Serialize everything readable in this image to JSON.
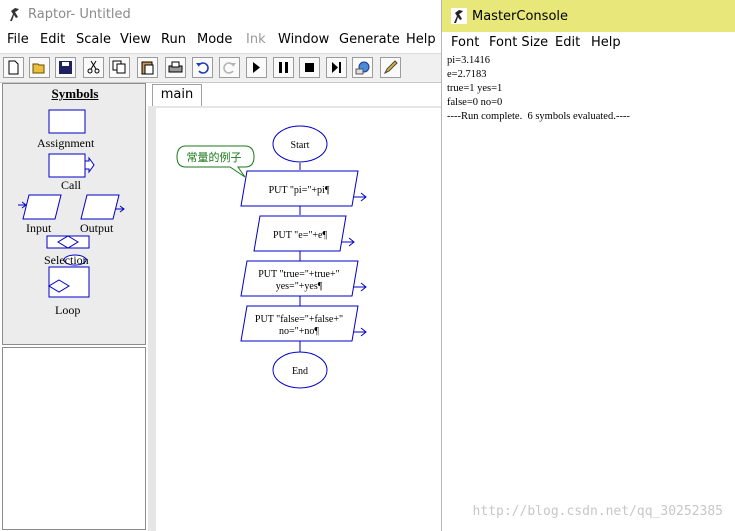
{
  "raptor": {
    "title": "Raptor- Untitled",
    "menu": [
      "File",
      "Edit",
      "Scale",
      "View",
      "Run",
      "Mode",
      "Ink",
      "Window",
      "Generate",
      "Help"
    ],
    "symbols": {
      "title": "Symbols",
      "assignment": "Assignment",
      "call": "Call",
      "input": "Input",
      "output": "Output",
      "selection": "Selection",
      "loop": "Loop"
    },
    "tab": "main",
    "flowchart": {
      "start": "Start",
      "end": "End",
      "comment": "常量的例子",
      "out1": "PUT \"pi=\"+pi¶",
      "out2": "PUT \"e=\"+e¶",
      "out3_l1": "PUT \"true=\"+true+\"",
      "out3_l2": "yes=\"+yes¶",
      "out4_l1": "PUT \"false=\"+false+\"",
      "out4_l2": "no=\"+no¶"
    }
  },
  "console": {
    "title": "MasterConsole",
    "menu": [
      "Font",
      "Font Size",
      "Edit",
      "Help"
    ],
    "output": "pi=3.1416\ne=2.7183\ntrue=1 yes=1\nfalse=0 no=0\n----Run complete.  6 symbols evaluated.----"
  },
  "watermark": "http://blog.csdn.net/qq_30252385",
  "colors": {
    "flowchart_blue": "#0000c8",
    "comment_green": "#1a7a1a",
    "console_title_bg": "#e8e87a"
  }
}
